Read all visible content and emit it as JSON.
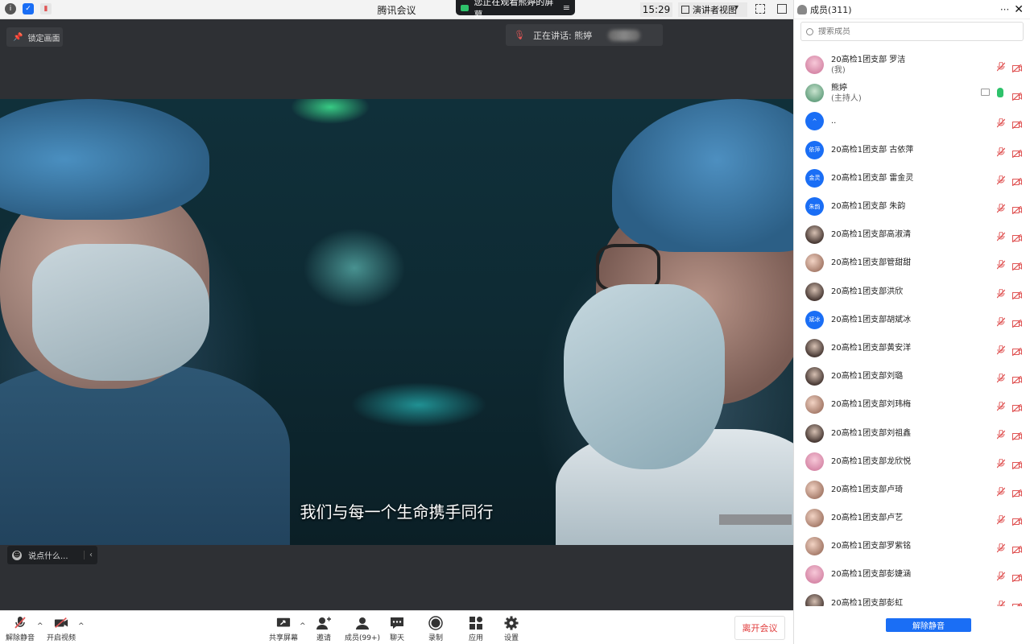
{
  "window": {
    "title": "腾讯会议",
    "share_banner": "您正在观看熊婷的屏幕",
    "time": "15:29",
    "view_label": "演讲者视图"
  },
  "meeting": {
    "pin_label": "锁定画面",
    "speaking_label": "正在讲话: 熊婷",
    "subtitle": "我们与每一个生命携手同行",
    "chat_placeholder": "说点什么..."
  },
  "toolbar": {
    "unmute_label": "解除静音",
    "video_label": "开启视频",
    "share_label": "共享屏幕",
    "invite_label": "邀请",
    "members_label": "成员(99+)",
    "chat_label": "聊天",
    "record_label": "录制",
    "apps_label": "应用",
    "settings_label": "设置",
    "leave_label": "离开会议"
  },
  "panel": {
    "title": "成员(311)",
    "search_placeholder": "搜索成员",
    "unmute_all_label": "解除静音",
    "members": [
      {
        "name": "20高检1团支部 罗洁",
        "sub": "(我)",
        "avatar": "photo3",
        "initials": ""
      },
      {
        "name": "熊婷",
        "sub": "(主持人)",
        "avatar": "photo4",
        "initials": "",
        "host": true
      },
      {
        "name": "..",
        "sub": "",
        "avatar": "blue",
        "initials": "^"
      },
      {
        "name": "20高检1团支部 古依萍",
        "sub": "",
        "avatar": "blue",
        "initials": "依萍"
      },
      {
        "name": "20高检1团支部 雷金灵",
        "sub": "",
        "avatar": "blue",
        "initials": "金灵"
      },
      {
        "name": "20高检1团支部 朱韵",
        "sub": "",
        "avatar": "blue",
        "initials": "朱韵"
      },
      {
        "name": "20高检1团支部高淑清",
        "sub": "",
        "avatar": "photo2",
        "initials": ""
      },
      {
        "name": "20高检1团支部管甜甜",
        "sub": "",
        "avatar": "photo",
        "initials": ""
      },
      {
        "name": "20高检1团支部洪欣",
        "sub": "",
        "avatar": "photo2",
        "initials": ""
      },
      {
        "name": "20高检1团支部胡斌冰",
        "sub": "",
        "avatar": "blue",
        "initials": "斌冰"
      },
      {
        "name": "20高检1团支部黄安洋",
        "sub": "",
        "avatar": "photo2",
        "initials": ""
      },
      {
        "name": "20高检1团支部刘璐",
        "sub": "",
        "avatar": "photo2",
        "initials": ""
      },
      {
        "name": "20高检1团支部刘玮梅",
        "sub": "",
        "avatar": "photo",
        "initials": ""
      },
      {
        "name": "20高检1团支部刘祖鑫",
        "sub": "",
        "avatar": "photo2",
        "initials": ""
      },
      {
        "name": "20高检1团支部龙欣悦",
        "sub": "",
        "avatar": "photo3",
        "initials": ""
      },
      {
        "name": "20高检1团支部卢琦",
        "sub": "",
        "avatar": "photo",
        "initials": ""
      },
      {
        "name": "20高检1团支部卢艺",
        "sub": "",
        "avatar": "photo",
        "initials": ""
      },
      {
        "name": "20高检1团支部罗紫铭",
        "sub": "",
        "avatar": "photo",
        "initials": ""
      },
      {
        "name": "20高检1团支部彭婕涵",
        "sub": "",
        "avatar": "photo3",
        "initials": ""
      },
      {
        "name": "20高检1团支部彭虹",
        "sub": "",
        "avatar": "photo2",
        "initials": ""
      }
    ]
  },
  "colors": {
    "accent": "#1a6ef5",
    "leave": "#e03a3a",
    "mic_on": "#2ec26b",
    "muted": "#e05555"
  }
}
